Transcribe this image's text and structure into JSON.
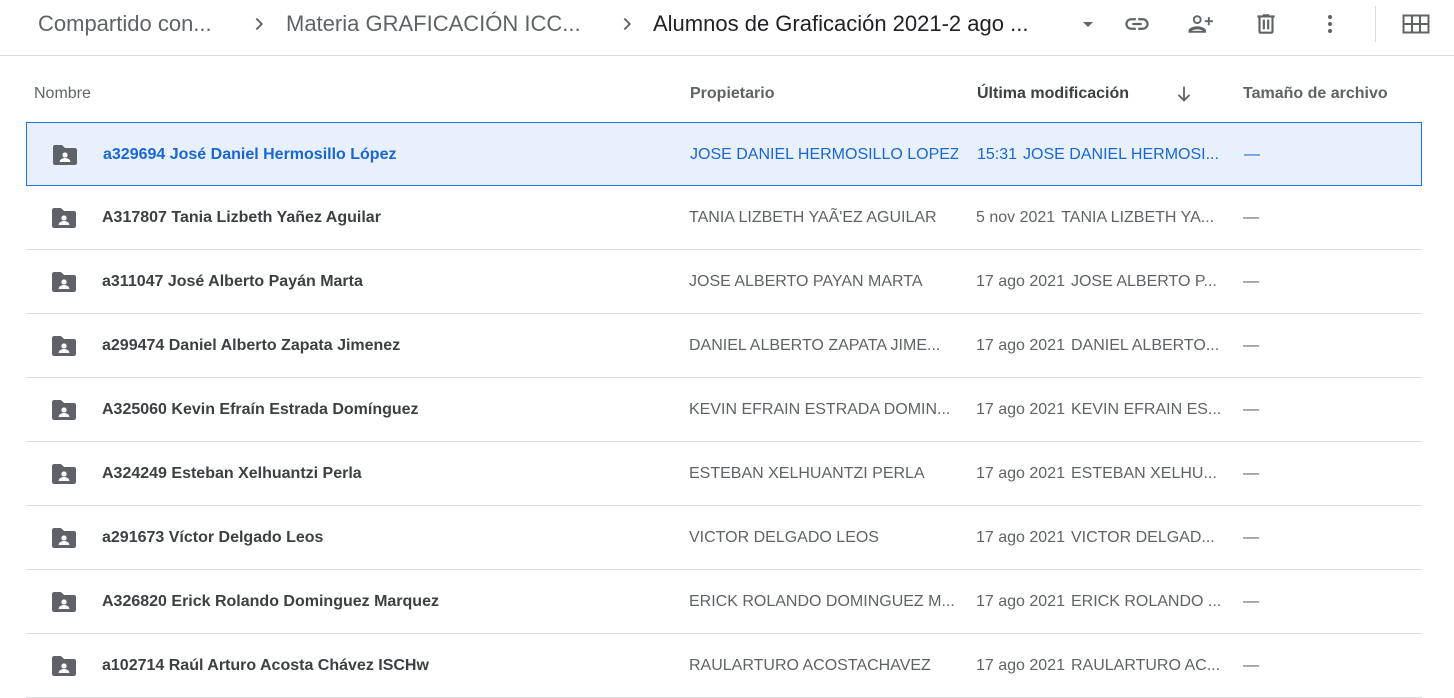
{
  "breadcrumb": {
    "items": [
      {
        "label": "Compartido con..."
      },
      {
        "label": "Materia GRAFICACIÓN ICC..."
      },
      {
        "label": "Alumnos de Graficación 2021-2 ago ..."
      }
    ]
  },
  "toolbar": {
    "icons": [
      "link-icon",
      "share-person-add-icon",
      "trash-icon",
      "more-vert-icon",
      "grid-view-icon"
    ]
  },
  "columns": {
    "name": "Nombre",
    "owner": "Propietario",
    "modified": "Última modificación",
    "size": "Tamaño de archivo"
  },
  "sort": {
    "column": "modified",
    "direction": "descending"
  },
  "colors": {
    "accent": "#1a73e8",
    "selected_bg": "#e8f0fe",
    "selected_text": "#1967d2",
    "icon": "#5f6368"
  },
  "rows": [
    {
      "name": "a329694 José Daniel Hermosillo López",
      "owner": "JOSE DANIEL HERMOSILLO LOPEZ",
      "modified_date": "15:31",
      "modified_by": "JOSE DANIEL HERMOSI...",
      "size": "—",
      "selected": true
    },
    {
      "name": "A317807 Tania Lizbeth Yañez Aguilar",
      "owner": "TANIA LIZBETH YAÃ'EZ AGUILAR",
      "modified_date": "5 nov 2021",
      "modified_by": "TANIA LIZBETH YA...",
      "size": "—"
    },
    {
      "name": "a311047 José Alberto Payán Marta",
      "owner": "JOSE ALBERTO PAYAN MARTA",
      "modified_date": "17 ago 2021",
      "modified_by": "JOSE ALBERTO P...",
      "size": "—"
    },
    {
      "name": "a299474 Daniel Alberto Zapata Jimenez",
      "owner": "DANIEL ALBERTO ZAPATA JIME...",
      "modified_date": "17 ago 2021",
      "modified_by": "DANIEL ALBERTO...",
      "size": "—"
    },
    {
      "name": "A325060 Kevin Efraín Estrada Domínguez",
      "owner": "KEVIN EFRAIN ESTRADA DOMIN...",
      "modified_date": "17 ago 2021",
      "modified_by": "KEVIN EFRAIN ES...",
      "size": "—"
    },
    {
      "name": "A324249 Esteban Xelhuantzi Perla",
      "owner": "ESTEBAN XELHUANTZI PERLA",
      "modified_date": "17 ago 2021",
      "modified_by": "ESTEBAN XELHU...",
      "size": "—"
    },
    {
      "name": "a291673 Víctor Delgado Leos",
      "owner": "VICTOR DELGADO LEOS",
      "modified_date": "17 ago 2021",
      "modified_by": "VICTOR DELGAD...",
      "size": "—"
    },
    {
      "name": "A326820 Erick Rolando Dominguez Marquez",
      "owner": "ERICK ROLANDO DOMINGUEZ M...",
      "modified_date": "17 ago 2021",
      "modified_by": "ERICK ROLANDO ...",
      "size": "—"
    },
    {
      "name": "a102714 Raúl Arturo Acosta Chávez ISCHw",
      "owner": "RAULARTURO ACOSTACHAVEZ",
      "modified_date": "17 ago 2021",
      "modified_by": "RAULARTURO AC...",
      "size": "—"
    }
  ]
}
